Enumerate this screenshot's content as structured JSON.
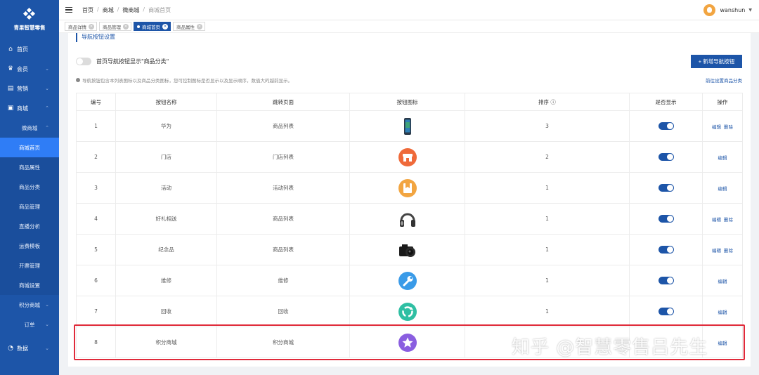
{
  "brand": {
    "name": "青果智慧零售"
  },
  "sidebar": {
    "items": [
      {
        "label": "首页",
        "icon": "home-icon",
        "glyph": "⌂"
      },
      {
        "label": "会员",
        "icon": "crown-icon",
        "glyph": "♛"
      },
      {
        "label": "营销",
        "icon": "bar-chart-icon",
        "glyph": "▤"
      },
      {
        "label": "商城",
        "icon": "store-icon",
        "glyph": "▣"
      }
    ],
    "sub": [
      {
        "label": "微商城",
        "group": true
      },
      {
        "label": "商城首页",
        "active": true
      },
      {
        "label": "商品属性"
      },
      {
        "label": "商品分类"
      },
      {
        "label": "商品管理"
      },
      {
        "label": "直播分析"
      },
      {
        "label": "运费模板"
      },
      {
        "label": "开票管理"
      },
      {
        "label": "商城设置"
      },
      {
        "label": "积分商城",
        "group": true
      },
      {
        "label": "订单",
        "group": true
      }
    ],
    "bottom": {
      "label": "数据",
      "icon": "pie-chart-icon",
      "glyph": "◔"
    }
  },
  "topbar": {
    "breadcrumb": [
      "首页",
      "商城",
      "微商城",
      "商城首页"
    ],
    "user": "wanshun"
  },
  "tabs": [
    {
      "label": "商品详情"
    },
    {
      "label": "商品管理"
    },
    {
      "label": "商城首页",
      "active": true
    },
    {
      "label": "商品属性"
    }
  ],
  "page": {
    "section_title": "导航按钮设置",
    "toggle_label": "首页导航按钮显示\"商品分类\"",
    "add_button": "+ 新增导航按钮",
    "hint": "导航按钮包含本列表图标以及商品分类图标，您可控制图标是否显示以及显示顺序，数值大的越前显示。",
    "link_right": "前往设置商品分类",
    "watermark": "知乎 @智慧零售吕先生"
  },
  "table": {
    "headers": [
      "编号",
      "按钮名称",
      "跳转页面",
      "按钮图标",
      "排序 ⓘ",
      "是否显示",
      "操作"
    ],
    "edit_label": "编辑",
    "delete_label": "删除",
    "rows": [
      {
        "id": "1",
        "name": "华为",
        "target": "商品列表",
        "icon": "phone-icon",
        "sort": "3",
        "shown": true,
        "ops": [
          "编辑",
          "删除"
        ]
      },
      {
        "id": "2",
        "name": "门店",
        "target": "门店列表",
        "icon": "shop-icon",
        "sort": "2",
        "shown": true,
        "ops": [
          "编辑"
        ]
      },
      {
        "id": "3",
        "name": "活动",
        "target": "活动列表",
        "icon": "bookmark-icon",
        "sort": "1",
        "shown": true,
        "ops": [
          "编辑"
        ]
      },
      {
        "id": "4",
        "name": "好礼相送",
        "target": "商品列表",
        "icon": "headphones-icon",
        "sort": "1",
        "shown": true,
        "ops": [
          "编辑",
          "删除"
        ]
      },
      {
        "id": "5",
        "name": "纪念品",
        "target": "商品列表",
        "icon": "camera-icon",
        "sort": "1",
        "shown": true,
        "ops": [
          "编辑",
          "删除"
        ]
      },
      {
        "id": "6",
        "name": "维修",
        "target": "维修",
        "icon": "wrench-icon",
        "sort": "1",
        "shown": true,
        "ops": [
          "编辑"
        ]
      },
      {
        "id": "7",
        "name": "回收",
        "target": "回收",
        "icon": "recycle-icon",
        "sort": "1",
        "shown": true,
        "ops": [
          "编辑"
        ]
      },
      {
        "id": "8",
        "name": "积分商城",
        "target": "积分商城",
        "icon": "star-icon",
        "sort": "",
        "shown": null,
        "ops": []
      }
    ]
  },
  "colors": {
    "primary": "#1d55a8",
    "active_sub": "#2f7df6",
    "highlight": "#e02a3a"
  }
}
